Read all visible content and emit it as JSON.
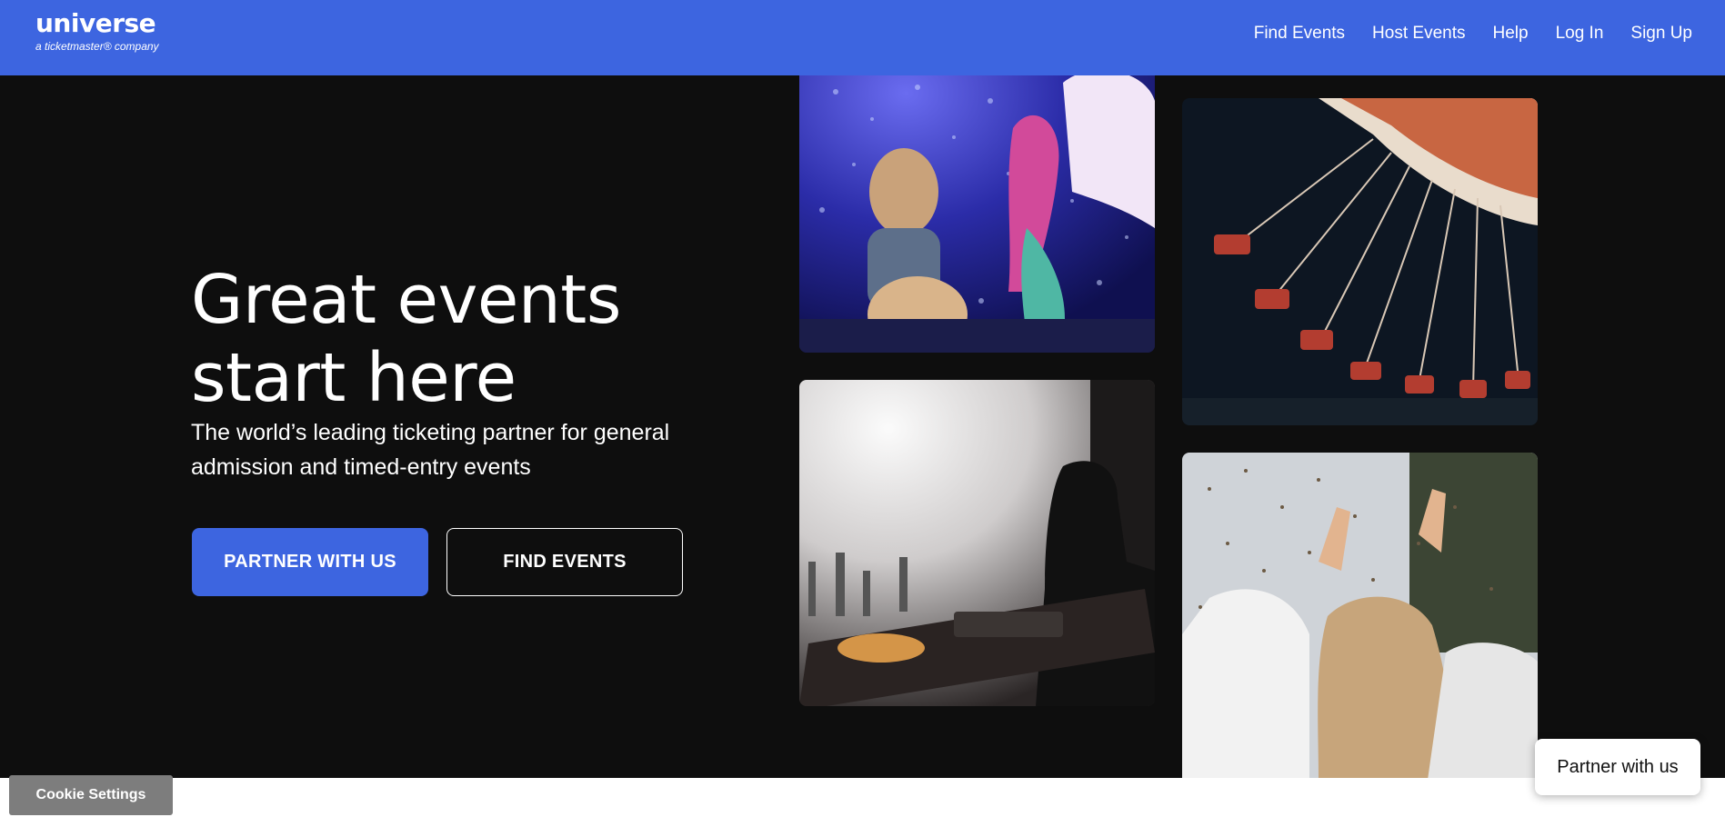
{
  "header": {
    "logo_word": "universe",
    "logo_sub": "a ticketmaster® company",
    "nav": [
      "Find Events",
      "Host Events",
      "Help",
      "Log In",
      "Sign Up"
    ],
    "bg_color": "#3d65e0"
  },
  "hero": {
    "headline_line1": "Great events",
    "headline_line2": "start here",
    "subhead": "The world’s leading ticketing partner for general admission and timed-entry events",
    "primary_button": "PARTNER WITH US",
    "secondary_button": "FIND EVENTS",
    "bg_color": "#0e0e0e",
    "images": [
      "child-with-mermaid-show-photo",
      "dj-at-turntables-photo",
      "swing-ride-at-night-photo",
      "confetti-crowd-photo"
    ]
  },
  "footer_widgets": {
    "cookie_settings": "Cookie Settings",
    "partner_chip": "Partner with us"
  }
}
